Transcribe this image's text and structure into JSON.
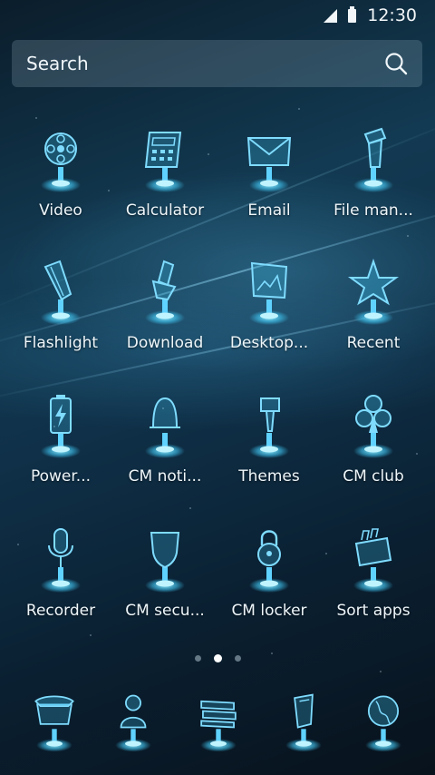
{
  "status_bar": {
    "time": "12:30"
  },
  "search": {
    "placeholder": "Search"
  },
  "apps": [
    [
      {
        "label": "Video",
        "icon": "film-reel-icon"
      },
      {
        "label": "Calculator",
        "icon": "calculator-icon"
      },
      {
        "label": "Email",
        "icon": "envelope-icon"
      },
      {
        "label": "File man...",
        "icon": "file-manager-icon"
      }
    ],
    [
      {
        "label": "Flashlight",
        "icon": "flashlight-icon"
      },
      {
        "label": "Download",
        "icon": "download-icon"
      },
      {
        "label": "Desktop...",
        "icon": "desktop-frame-icon"
      },
      {
        "label": "Recent",
        "icon": "star-icon"
      }
    ],
    [
      {
        "label": "Power...",
        "icon": "battery-icon"
      },
      {
        "label": "CM noti...",
        "icon": "bell-icon"
      },
      {
        "label": "Themes",
        "icon": "paint-brush-icon"
      },
      {
        "label": "CM club",
        "icon": "club-icon"
      }
    ],
    [
      {
        "label": "Recorder",
        "icon": "microphone-icon"
      },
      {
        "label": "CM secu...",
        "icon": "shield-icon"
      },
      {
        "label": "CM locker",
        "icon": "padlock-icon"
      },
      {
        "label": "Sort apps",
        "icon": "sort-apps-icon"
      }
    ]
  ],
  "pager": {
    "pages": 3,
    "active": 1
  },
  "dock": [
    {
      "icon": "phone-icon"
    },
    {
      "icon": "contacts-icon"
    },
    {
      "icon": "messages-icon"
    },
    {
      "icon": "camera-icon"
    },
    {
      "icon": "browser-globe-icon"
    }
  ],
  "colors": {
    "glow": "#3fc4f0",
    "accent": "#7fdcff",
    "text": "#eef6fa"
  }
}
